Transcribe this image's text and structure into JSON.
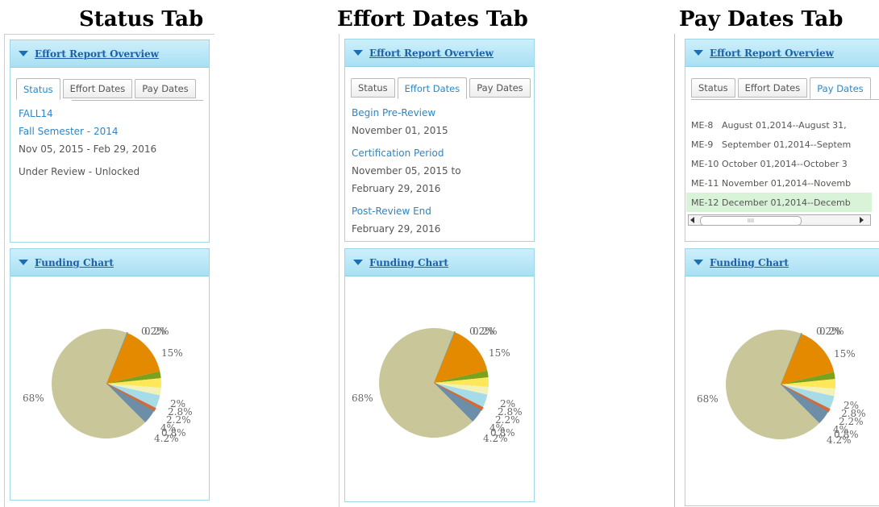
{
  "headings": {
    "status": "Status  Tab",
    "effort": "Effort Dates Tab",
    "pay": "Pay Dates Tab"
  },
  "overview_title": "Effort Report Overview",
  "funding_title": "Funding Chart",
  "tabs": [
    "Status",
    "Effort Dates",
    "Pay Dates"
  ],
  "status_tab": {
    "term_code": "FALL14",
    "term_name": "Fall Semester - 2014",
    "date_range": "Nov 05, 2015 - Feb 29, 2016",
    "state": "Under Review - Unlocked"
  },
  "effort_tab": {
    "begin_label": "Begin Pre-Review",
    "begin_date": "November 01, 2015",
    "cert_label": "Certification Period",
    "cert_line1": "November 05, 2015 to",
    "cert_line2": "February 29, 2016",
    "post_label": "Post-Review End",
    "post_date": "February 29, 2016"
  },
  "pay_tab": {
    "rows": [
      {
        "code": "ME-8",
        "range": "August 01,2014--August 31,",
        "selected": false
      },
      {
        "code": "ME-9",
        "range": "September 01,2014--Septem",
        "selected": false
      },
      {
        "code": "ME-10",
        "range": "October 01,2014--October 3",
        "selected": false
      },
      {
        "code": "ME-11",
        "range": "November 01,2014--Novemb",
        "selected": false
      },
      {
        "code": "ME-12",
        "range": "December 01,2014--Decemb",
        "selected": true
      }
    ],
    "scroll_grip": "IIII"
  },
  "pie_labels": {
    "tiny": "0.2%",
    "tiny_overlap": "0.2%",
    "big_orange": "15%",
    "main": "68%",
    "s1": "2%",
    "s2": "2.8%",
    "s3": "2.2%",
    "s4": "4%",
    "s5": "0.8%",
    "s6": "4.2%"
  },
  "chart_data": {
    "type": "pie",
    "slices": [
      {
        "label": "0.2%",
        "value": 0.2,
        "color": "#4fa3d8"
      },
      {
        "label": "15%",
        "value": 15,
        "color": "#e38a00"
      },
      {
        "label": "2%",
        "value": 2,
        "color": "#7aa21c"
      },
      {
        "label": "2.8%",
        "value": 2.8,
        "color": "#ffe75a"
      },
      {
        "label": "2.2%",
        "value": 2.2,
        "color": "#f2f2b8"
      },
      {
        "label": "4%",
        "value": 4,
        "color": "#a6dbe8"
      },
      {
        "label": "0.8%",
        "value": 0.8,
        "color": "#d46a3a"
      },
      {
        "label": "4.2%",
        "value": 4.2,
        "color": "#6c8ea6"
      },
      {
        "label": "68%",
        "value": 68,
        "color": "#c9c79a"
      }
    ]
  }
}
